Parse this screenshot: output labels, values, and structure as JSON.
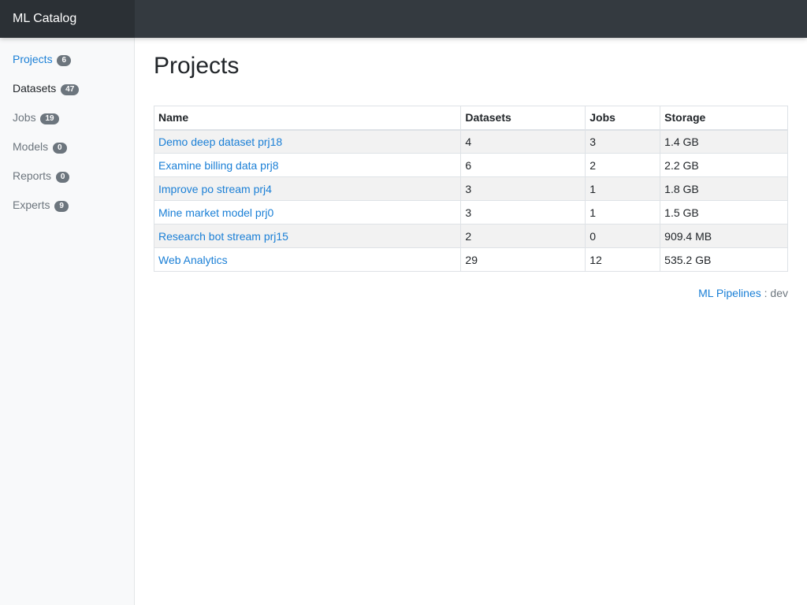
{
  "app": {
    "brand": "ML Catalog"
  },
  "sidebar": {
    "items": [
      {
        "label": "Projects",
        "count": "6"
      },
      {
        "label": "Datasets",
        "count": "47"
      },
      {
        "label": "Jobs",
        "count": "19"
      },
      {
        "label": "Models",
        "count": "0"
      },
      {
        "label": "Reports",
        "count": "0"
      },
      {
        "label": "Experts",
        "count": "9"
      }
    ]
  },
  "main": {
    "title": "Projects",
    "table": {
      "columns": [
        "Name",
        "Datasets",
        "Jobs",
        "Storage"
      ],
      "rows": [
        {
          "name": "Demo deep dataset prj18",
          "datasets": "4",
          "jobs": "3",
          "storage": "1.4 GB"
        },
        {
          "name": "Examine billing data prj8",
          "datasets": "6",
          "jobs": "2",
          "storage": "2.2 GB"
        },
        {
          "name": "Improve po stream prj4",
          "datasets": "3",
          "jobs": "1",
          "storage": "1.8 GB"
        },
        {
          "name": "Mine market model prj0",
          "datasets": "3",
          "jobs": "1",
          "storage": "1.5 GB"
        },
        {
          "name": "Research bot stream prj15",
          "datasets": "2",
          "jobs": "0",
          "storage": "909.4 MB"
        },
        {
          "name": "Web Analytics",
          "datasets": "29",
          "jobs": "12",
          "storage": "535.2 GB"
        }
      ]
    },
    "footer": {
      "link": "ML Pipelines",
      "separator": " : ",
      "env": "dev"
    }
  },
  "colors": {
    "navbar": "#343a40",
    "brand_bg": "#2b3035",
    "link": "#1a7fd6",
    "badge": "#6c757d",
    "sidebar_bg": "#f8f9fa"
  }
}
